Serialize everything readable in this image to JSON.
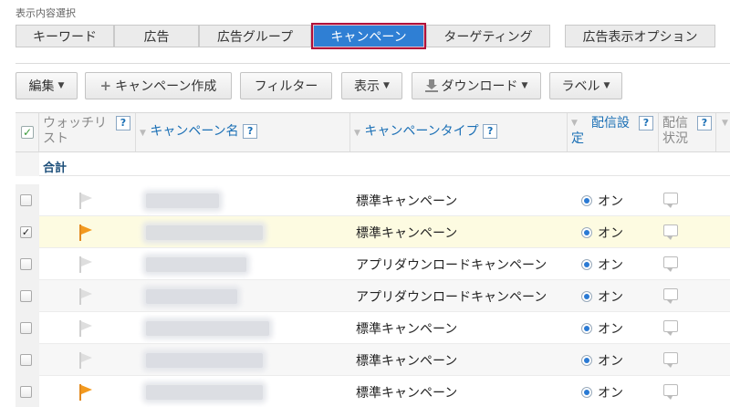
{
  "view_selector": {
    "label": "表示内容選択",
    "tabs": [
      {
        "label": "キーワード",
        "active": false
      },
      {
        "label": "広告",
        "active": false
      },
      {
        "label": "広告グループ",
        "active": false
      },
      {
        "label": "キャンペーン",
        "active": true
      },
      {
        "label": "ターゲティング",
        "active": false
      },
      {
        "label": "広告表示オプション",
        "active": false
      }
    ]
  },
  "toolbar": {
    "edit": "編集",
    "create_campaign": "キャンペーン作成",
    "filter": "フィルター",
    "display": "表示",
    "download": "ダウンロード",
    "label": "ラベル"
  },
  "table": {
    "headers": {
      "watch_list": "ウォッチリスト",
      "campaign_name": "キャンペーン名",
      "campaign_type": "キャンペーンタイプ",
      "delivery_setting": "配信設定",
      "delivery_status": "配信状況",
      "help": "?"
    },
    "total_label": "合計",
    "rows": [
      {
        "checked": false,
        "watched": false,
        "type": "標準キャンペーン",
        "status": "オン"
      },
      {
        "checked": true,
        "watched": true,
        "type": "標準キャンペーン",
        "status": "オン"
      },
      {
        "checked": false,
        "watched": false,
        "type": "アプリダウンロードキャンペーン",
        "status": "オン"
      },
      {
        "checked": false,
        "watched": false,
        "type": "アプリダウンロードキャンペーン",
        "status": "オン"
      },
      {
        "checked": false,
        "watched": false,
        "type": "標準キャンペーン",
        "status": "オン"
      },
      {
        "checked": false,
        "watched": false,
        "type": "標準キャンペーン",
        "status": "オン"
      },
      {
        "checked": false,
        "watched": true,
        "type": "標準キャンペーン",
        "status": "オン"
      }
    ]
  },
  "colors": {
    "active_tab": "#2f7fd4",
    "active_tab_border": "#b0103a",
    "link_blue": "#1a6fb5",
    "flag_on": "#f39a1f",
    "selected_row": "#fdfbe1"
  }
}
